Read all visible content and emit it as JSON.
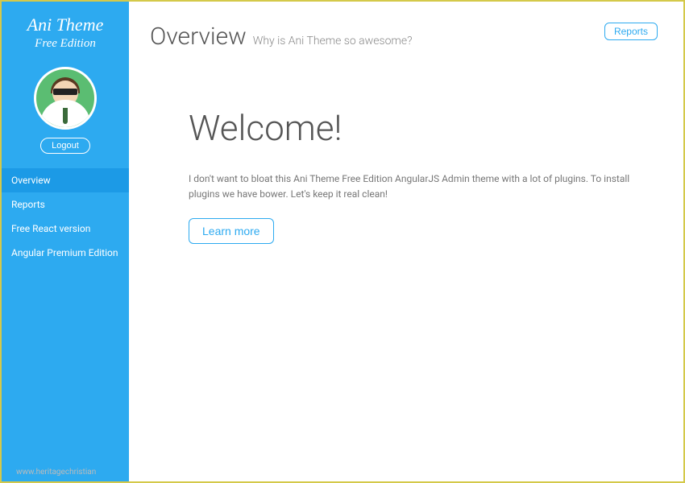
{
  "sidebar": {
    "brand_title": "Ani Theme",
    "brand_subtitle": "Free Edition",
    "logout_label": "Logout",
    "nav": [
      {
        "label": "Overview",
        "active": true
      },
      {
        "label": "Reports",
        "active": false
      },
      {
        "label": "Free React version",
        "active": false
      },
      {
        "label": "Angular Premium Edition",
        "active": false
      }
    ]
  },
  "header": {
    "title": "Overview",
    "subtitle": "Why is Ani Theme so awesome?",
    "reports_button": "Reports"
  },
  "content": {
    "welcome_title": "Welcome!",
    "welcome_text": "I don't want to bloat this Ani Theme Free Edition AngularJS Admin theme with a lot of plugins. To install plugins we have bower. Let's keep it real clean!",
    "learn_more_label": "Learn more"
  },
  "watermark": "www.heritagechristian"
}
